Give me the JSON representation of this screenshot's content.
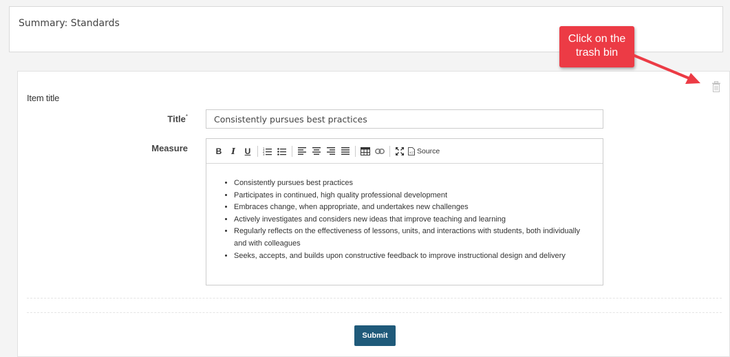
{
  "summary": {
    "title": "Summary: Standards"
  },
  "item": {
    "heading": "Item title",
    "title_label": "Title",
    "title_required_mark": "*",
    "title_value": "Consistently pursues best practices",
    "measure_label": "Measure",
    "trash_icon": "trash-icon"
  },
  "editor": {
    "toolbar": {
      "bold": "B",
      "italic": "I",
      "underline": "U",
      "source_label": "Source"
    },
    "bullets": [
      "Consistently pursues best practices",
      "Participates in continued, high quality professional development",
      "Embraces change, when appropriate, and undertakes new challenges",
      "Actively investigates and considers new ideas that improve teaching and learning",
      "Regularly reflects on the effectiveness of lessons, units, and interactions with students, both individually and with colleagues",
      "Seeks, accepts, and builds upon constructive feedback to improve instructional design and delivery"
    ]
  },
  "submit_label": "Submit",
  "callout": {
    "line1": "Click on the",
    "line2": "trash bin",
    "color": "#ec3b45"
  },
  "colors": {
    "submit_bg": "#1f5a7a",
    "page_bg": "#f4f4f4"
  }
}
